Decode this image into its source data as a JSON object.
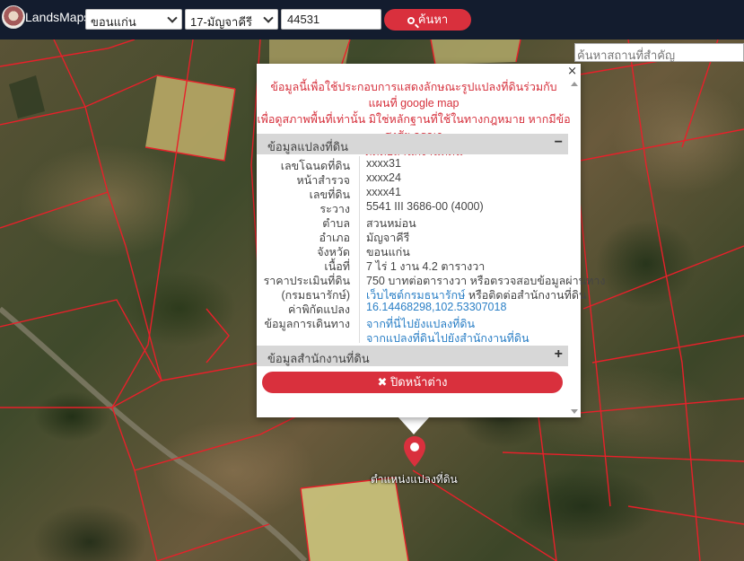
{
  "header": {
    "brand": "LandsMaps",
    "province_select": "ขอนแก่น",
    "district_select": "17-มัญจาคีรี",
    "parcel_number": "44531",
    "search_button": "ค้นหา"
  },
  "place_search": {
    "placeholder": "ค้นหาสถานที่สำคัญ"
  },
  "popup": {
    "close": "×",
    "notice": [
      "ข้อมูลนี้เพื่อใช้ประกอบการแสดงลักษณะรูปแปลงที่ดินร่วมกับแผนที่ google map",
      "เพื่อดูสภาพพื้นที่เท่านั้น มิใช่หลักฐานที่ใช้ในทางกฎหมาย หากมีข้อสงสัย กรุณา",
      "ติดต่อสำนักงานที่ดิน"
    ],
    "section_parcel": {
      "title": "ข้อมูลแปลงที่ดิน",
      "toggle": "−"
    },
    "rows": [
      {
        "key": "เลขโฉนดที่ดิน",
        "value": "xxxx31"
      },
      {
        "key": "หน้าสำรวจ",
        "value": "xxxx24"
      },
      {
        "key": "เลขที่ดิน",
        "value": "xxxx41"
      },
      {
        "key": "ระวาง",
        "value": "5541 III 3686-00 (4000)"
      },
      {
        "key": "ตำบล",
        "value": "สวนหม่อน"
      },
      {
        "key": "อำเภอ",
        "value": "มัญจาคีรี"
      },
      {
        "key": "จังหวัด",
        "value": "ขอนแก่น"
      },
      {
        "key": "เนื้อที่",
        "value": "7 ไร่ 1 งาน 4.2 ตารางวา"
      },
      {
        "key": "ราคาประเมินที่ดิน",
        "value": "750 บาทต่อตารางวา หรือตรวจสอบข้อมูลผ่านทาง"
      },
      {
        "key": "(กรมธนารักษ์)",
        "value_link": "เว็บไซต์กรมธนารักษ์",
        "value": " หรือติดต่อสำนักงานที่ดิน"
      },
      {
        "key": "ค่าพิกัดแปลง",
        "value_link": "16.14468298,102.53307018"
      },
      {
        "key": "ข้อมูลการเดินทาง",
        "value_link": "จากที่นี่ไปยังแปลงที่ดิน"
      },
      {
        "key": "",
        "value_link": "จากแปลงที่ดินไปยังสำนักงานที่ดิน"
      }
    ],
    "section_office": {
      "title": "ข้อมูลสำนักงานที่ดิน",
      "toggle": "+"
    },
    "close_button": "ปิดหน้าต่าง"
  },
  "marker": {
    "label": "ตำแหน่งแปลงที่ดิน",
    "color": "#d9303d"
  },
  "colors": {
    "navbar": "#131c2e",
    "accent": "#d9303d",
    "link": "#2a7fc6",
    "parcel_line": "#e8202a"
  }
}
